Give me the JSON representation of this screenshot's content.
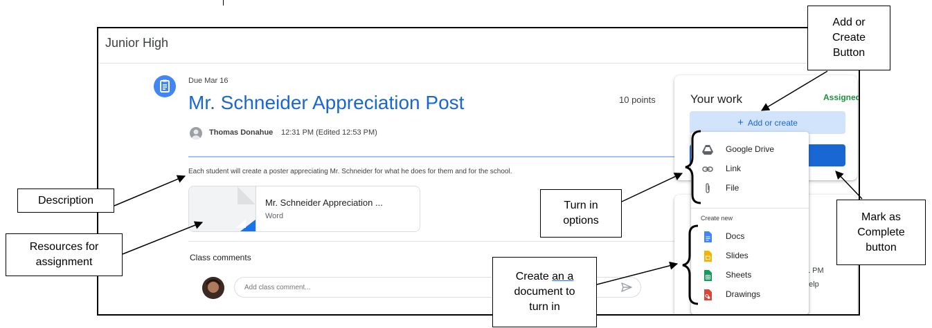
{
  "header": {
    "class_name": "Junior High"
  },
  "assignment": {
    "due": "Due Mar 16",
    "title": "Mr. Schneider Appreciation Post",
    "points": "10 points",
    "author": "Thomas Donahue",
    "post_time": "12:31 PM (Edited 12:53 PM)",
    "description": "Each student will create a poster appreciating Mr. Schneider for what he does for them and for the school."
  },
  "resource": {
    "title": "Mr. Schneider Appreciation ...",
    "type": "Word"
  },
  "comments": {
    "label": "Class comments",
    "placeholder": "Add class comment..."
  },
  "your_work": {
    "title": "Your work",
    "status": "Assigned",
    "add_create_label": "Add or create",
    "add_create_icon": "+",
    "second_card_time": "1 PM",
    "second_card_help": "help"
  },
  "menu": {
    "items": [
      {
        "label": "Google Drive",
        "icon": "google-drive-icon"
      },
      {
        "label": "Link",
        "icon": "link-icon"
      },
      {
        "label": "File",
        "icon": "paperclip-icon"
      }
    ],
    "create_new_label": "Create new",
    "create_items": [
      {
        "label": "Docs",
        "icon": "docs-icon",
        "color": "#4285f4"
      },
      {
        "label": "Slides",
        "icon": "slides-icon",
        "color": "#f4b400"
      },
      {
        "label": "Sheets",
        "icon": "sheets-icon",
        "color": "#0f9d58"
      },
      {
        "label": "Drawings",
        "icon": "drawings-icon",
        "color": "#db4437"
      }
    ]
  },
  "annotations": {
    "add_create": "Add or\nCreate\nButton",
    "description": "Description",
    "resources": "Resources for\nassignment",
    "turn_in": "Turn in\noptions",
    "create_doc_pre": "Create ",
    "create_doc_underlined": "an a",
    "create_doc_post": "\ndocument to\nturn in",
    "mark_complete": "Mark as\nComplete\nbutton"
  },
  "colors": {
    "accent": "#1967d2",
    "assigned": "#1e8e3e",
    "add_create_bg": "#d2e3fc"
  }
}
